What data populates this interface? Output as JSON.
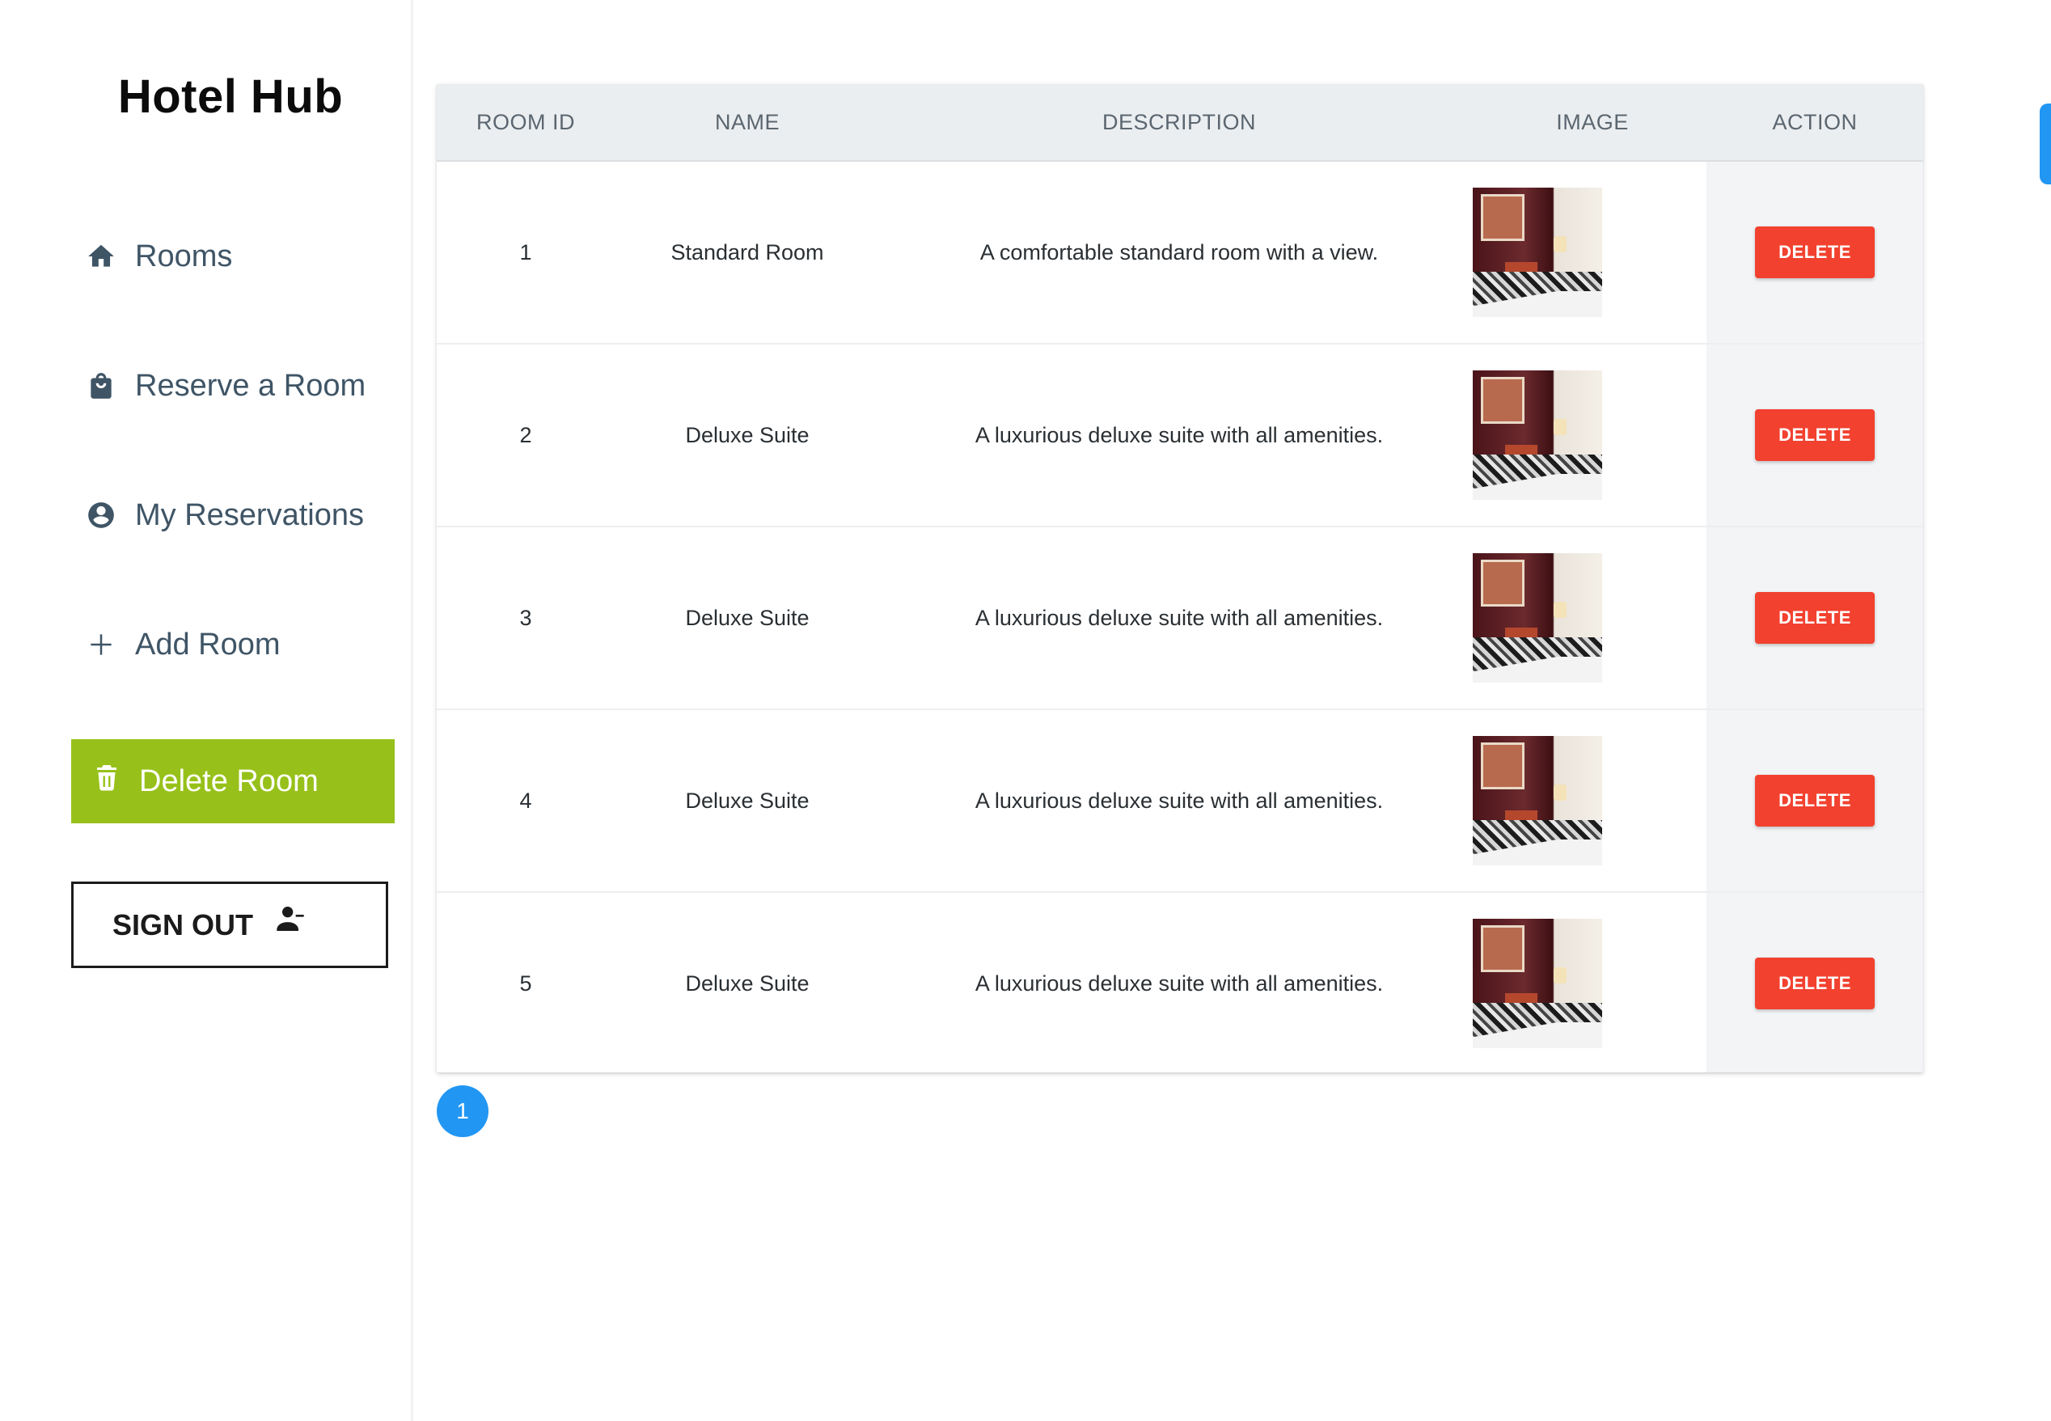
{
  "app": {
    "brand": "Hotel Hub"
  },
  "sidebar": {
    "items": [
      {
        "label": "Rooms",
        "icon": "home-icon"
      },
      {
        "label": "Reserve a Room",
        "icon": "shopping-bag-icon"
      },
      {
        "label": "My Reservations",
        "icon": "account-circle-icon"
      },
      {
        "label": "Add Room",
        "icon": "plus-icon"
      },
      {
        "label": "Delete Room",
        "icon": "trash-icon",
        "active": true
      }
    ],
    "signout_label": "SIGN OUT",
    "signout_icon": "person-remove-icon",
    "active_color": "#97c11a"
  },
  "table": {
    "headers": [
      "ROOM ID",
      "NAME",
      "DESCRIPTION",
      "IMAGE",
      "ACTION"
    ],
    "rows": [
      {
        "id": "1",
        "name": "Standard Room",
        "description": "A comfortable standard room with a view.",
        "action": "DELETE"
      },
      {
        "id": "2",
        "name": "Deluxe Suite",
        "description": "A luxurious deluxe suite with all amenities.",
        "action": "DELETE"
      },
      {
        "id": "3",
        "name": "Deluxe Suite",
        "description": "A luxurious deluxe suite with all amenities.",
        "action": "DELETE"
      },
      {
        "id": "4",
        "name": "Deluxe Suite",
        "description": "A luxurious deluxe suite with all amenities.",
        "action": "DELETE"
      },
      {
        "id": "5",
        "name": "Deluxe Suite",
        "description": "A luxurious deluxe suite with all amenities.",
        "action": "DELETE"
      }
    ],
    "delete_color": "#f2412f"
  },
  "pagination": {
    "current_page": "1",
    "color": "#2196f3"
  }
}
